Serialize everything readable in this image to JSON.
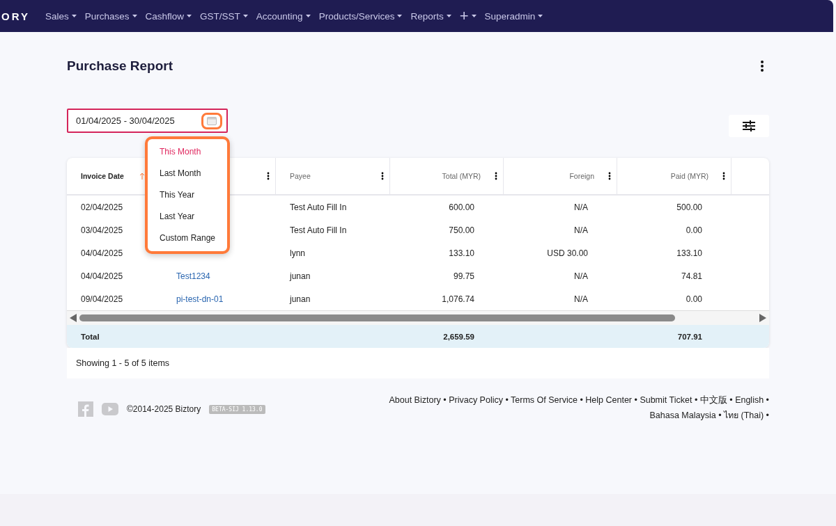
{
  "nav": {
    "brand": "ORY",
    "items": [
      {
        "label": "Sales"
      },
      {
        "label": "Purchases"
      },
      {
        "label": "Cashflow"
      },
      {
        "label": "GST/SST"
      },
      {
        "label": "Accounting"
      },
      {
        "label": "Products/Services"
      },
      {
        "label": "Reports"
      },
      {
        "label": "+"
      },
      {
        "label": "Superadmin"
      }
    ]
  },
  "page": {
    "title": "Purchase Report"
  },
  "date_range": {
    "value": "01/04/2025 - 30/04/2025"
  },
  "range_menu": [
    {
      "label": "This Month",
      "selected": true
    },
    {
      "label": "Last Month",
      "selected": false
    },
    {
      "label": "This Year",
      "selected": false
    },
    {
      "label": "Last Year",
      "selected": false
    },
    {
      "label": "Custom Range",
      "selected": false
    }
  ],
  "table": {
    "columns": [
      {
        "label": "Invoice Date",
        "sorted": true
      },
      {
        "sorted": false
      },
      {
        "label": "Payee",
        "sorted": false
      },
      {
        "label": "Total (MYR)",
        "sorted": false
      },
      {
        "label": "Foreign",
        "sorted": false
      },
      {
        "label": "Paid (MYR)",
        "sorted": false
      }
    ],
    "rows": [
      [
        "02/04/2025",
        "",
        "Test Auto Fill In",
        "600.00",
        "N/A",
        "500.00"
      ],
      [
        "03/04/2025",
        "",
        "Test Auto Fill In",
        "750.00",
        "N/A",
        "0.00"
      ],
      [
        "04/04/2025",
        "",
        "lynn",
        "133.10",
        "USD 30.00",
        "133.10"
      ],
      [
        "04/04/2025",
        "Test1234",
        "junan",
        "99.75",
        "N/A",
        "74.81"
      ],
      [
        "09/04/2025",
        "pi-test-dn-01",
        "junan",
        "1,076.74",
        "N/A",
        "0.00"
      ]
    ],
    "totals": {
      "label": "Total",
      "total": "2,659.59",
      "paid": "707.91"
    }
  },
  "pagination": "Showing 1 - 5 of 5 items",
  "footer": {
    "separator": "•",
    "copyright": "©2014-2025 Biztory",
    "version": "BETA-SIJ 1.13.0",
    "links": [
      "About Biztory",
      "Privacy Policy",
      "Terms Of Service",
      "Help Center",
      "Submit Ticket",
      "中文版",
      "English",
      "Bahasa Malaysia",
      "ไทย (Thai)"
    ]
  }
}
